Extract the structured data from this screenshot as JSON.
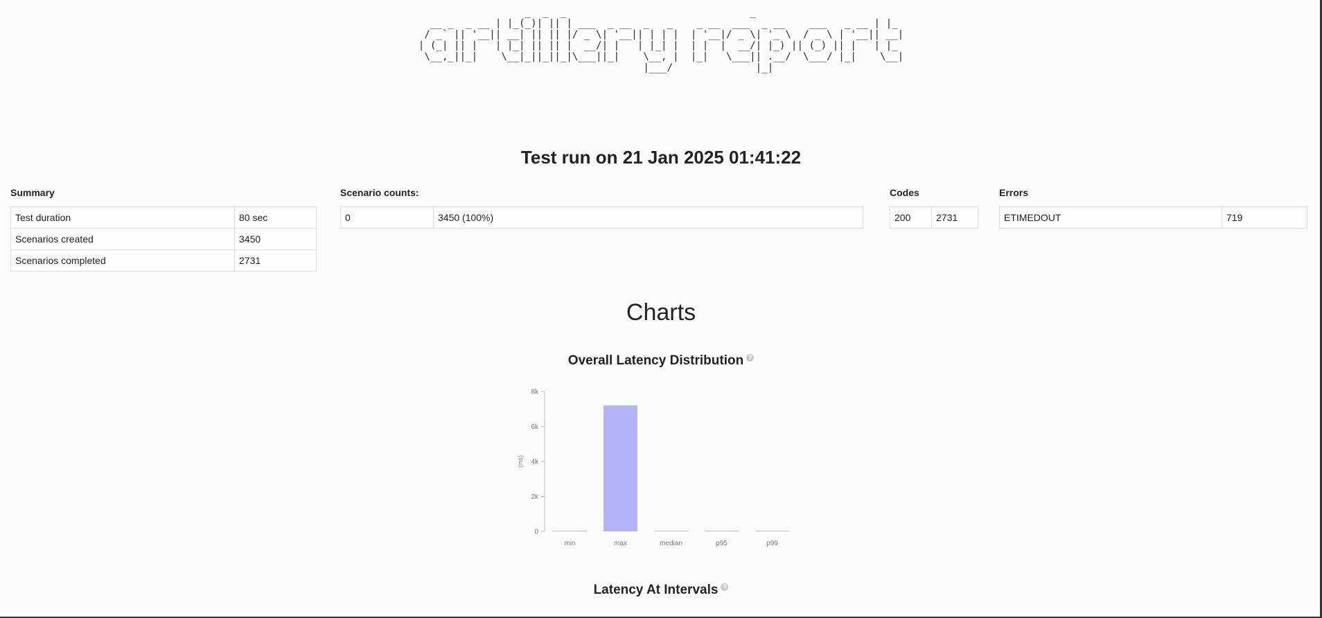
{
  "logo_text": "artillery report",
  "title": "Test run on 21 Jan 2025 01:41:22",
  "summary": {
    "heading": "Summary",
    "rows": [
      {
        "label": "Test duration",
        "value": "80 sec"
      },
      {
        "label": "Scenarios created",
        "value": "3450"
      },
      {
        "label": "Scenarios completed",
        "value": "2731"
      }
    ]
  },
  "scenario_counts": {
    "heading": "Scenario counts:",
    "rows": [
      {
        "label": "0",
        "value": "3450 (100%)"
      }
    ]
  },
  "codes": {
    "heading": "Codes",
    "rows": [
      {
        "label": "200",
        "value": "2731"
      }
    ]
  },
  "errors": {
    "heading": "Errors",
    "rows": [
      {
        "label": "ETIMEDOUT",
        "value": "719"
      }
    ]
  },
  "charts_heading": "Charts",
  "latency_distribution": {
    "title": "Overall Latency Distribution",
    "help_icon": "question-circle-icon",
    "help_glyph": "?"
  },
  "latency_intervals": {
    "title": "Latency At Intervals",
    "help_icon": "question-circle-icon",
    "help_glyph": "?"
  },
  "chart_data": {
    "type": "bar",
    "title": "Overall Latency Distribution",
    "categories": [
      "min",
      "max",
      "median",
      "p95",
      "p99"
    ],
    "values": [
      2,
      7200,
      5,
      10,
      15
    ],
    "ylabel": "(ms)",
    "xlabel": "",
    "ylim": [
      0,
      8000
    ],
    "yticks": [
      0,
      2000,
      4000,
      6000,
      8000
    ],
    "ytick_labels": [
      "0",
      "2k",
      "4k",
      "6k",
      "8k"
    ],
    "bar_color": "#b3b3f7",
    "grid": false
  }
}
